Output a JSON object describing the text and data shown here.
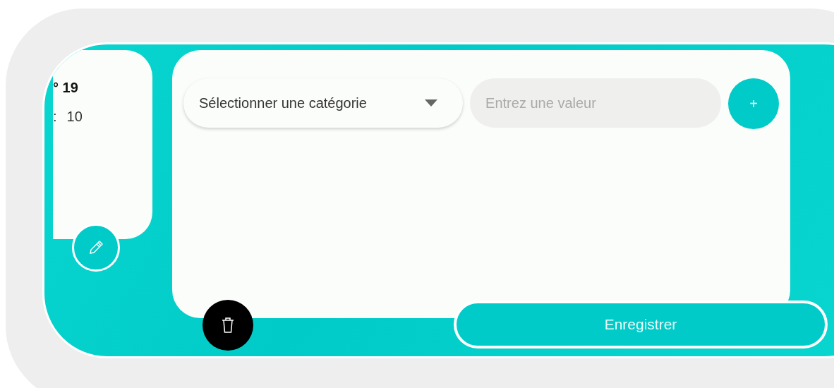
{
  "summary_card": {
    "title": "° 19",
    "separator": ":",
    "value": "10"
  },
  "form": {
    "category_select": {
      "value": "Sélectionner une catégorie"
    },
    "value_input": {
      "placeholder": "Entrez une valeur"
    },
    "add_button": "+"
  },
  "save_button": "Enregistrer"
}
